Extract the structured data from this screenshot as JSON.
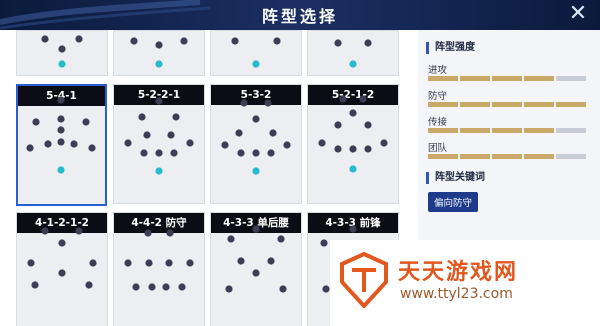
{
  "header": {
    "title": "阵型选择",
    "close_label": "✕"
  },
  "formations": [
    {
      "name": "5-4-1",
      "selected": true
    },
    {
      "name": "5-2-2-1",
      "selected": false
    },
    {
      "name": "5-3-2",
      "selected": false
    },
    {
      "name": "5-2-1-2",
      "selected": false
    },
    {
      "name": "4-1-2-1-2",
      "selected": false
    },
    {
      "name": "4-4-2 防守",
      "selected": false
    },
    {
      "name": "4-3-3 单后腰",
      "selected": false
    },
    {
      "name": "4-3-3 前锋",
      "selected": false
    }
  ],
  "info": {
    "strength_title": "阵型强度",
    "stats": [
      {
        "label": "进攻",
        "level": 4,
        "max": 5
      },
      {
        "label": "防守",
        "level": 5,
        "max": 5
      },
      {
        "label": "传接",
        "level": 4,
        "max": 5
      },
      {
        "label": "团队",
        "level": 4,
        "max": 5
      }
    ],
    "keyword_title": "阵型关键词",
    "keyword_tag": "偏向防守"
  },
  "watermark": {
    "brand": "天天游戏网",
    "url": "www.ttyl23.com"
  },
  "colors": {
    "player": "#3d3e55",
    "keeper": "#27b9cf",
    "selected_border": "#2a5fd0",
    "bar_on": "#c8a96a",
    "bar_off": "#c8ccd4",
    "tag_bg": "#1e3a8a"
  }
}
